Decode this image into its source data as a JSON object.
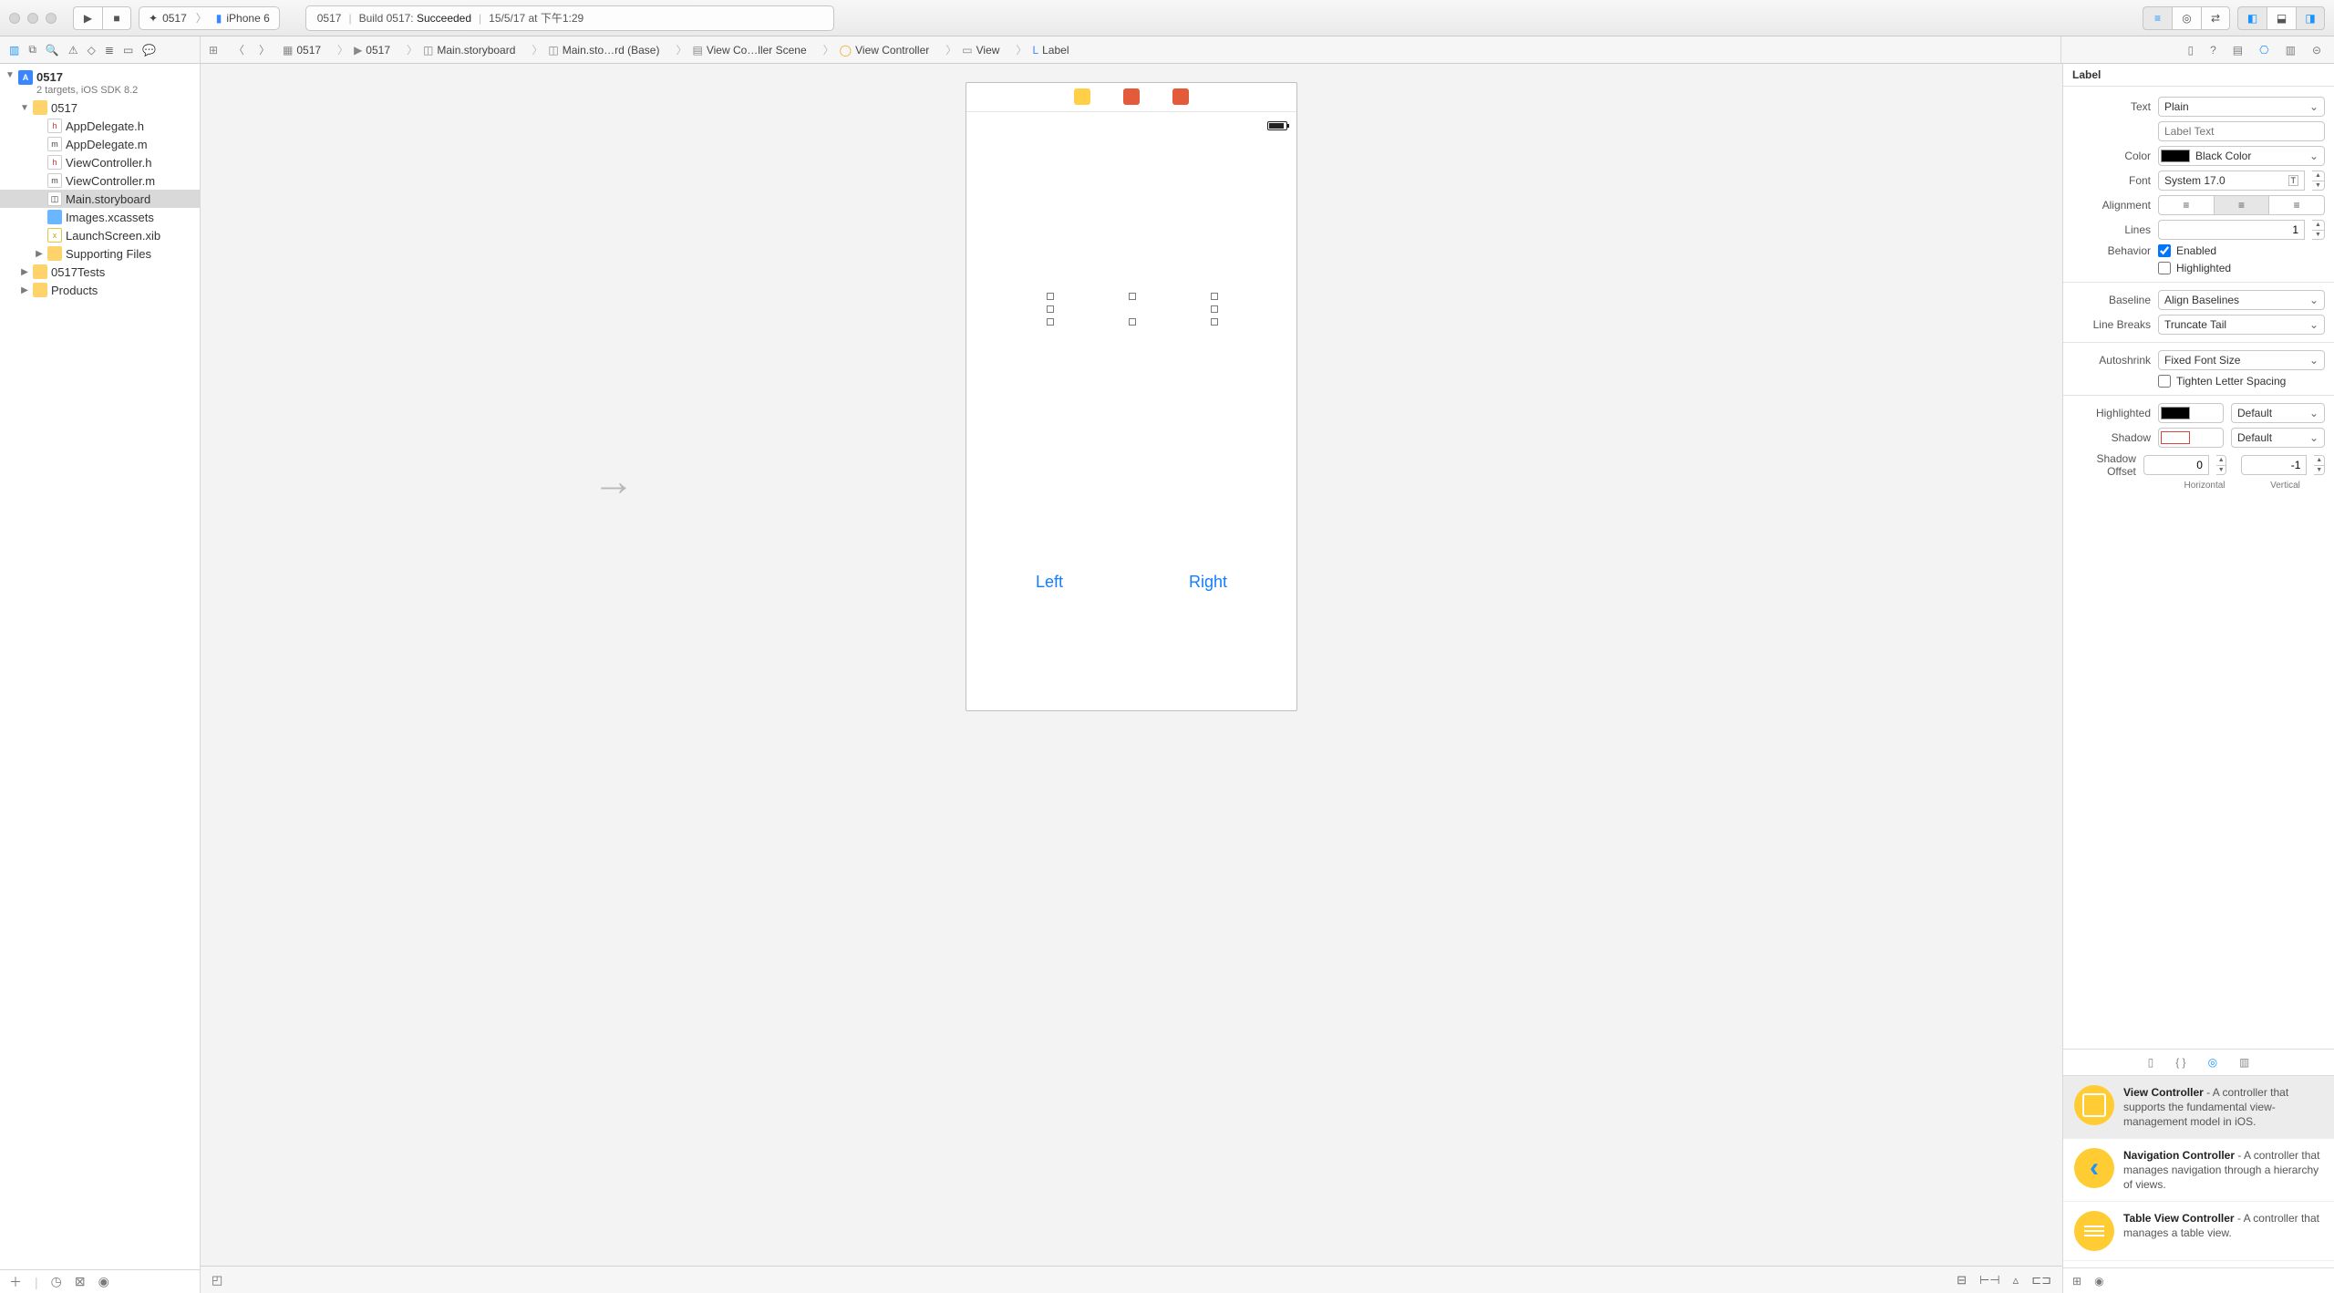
{
  "toolbar": {
    "scheme_target": "0517",
    "scheme_device": "iPhone 6",
    "activity_prefix": "0517",
    "activity_build": "Build 0517:",
    "activity_status": "Succeeded",
    "activity_time": "15/5/17 at 下午1:29"
  },
  "breadcrumbs": [
    {
      "label": "0517",
      "icon": "proj"
    },
    {
      "label": "0517",
      "icon": "folder"
    },
    {
      "label": "Main.storyboard",
      "icon": "sb"
    },
    {
      "label": "Main.sto…rd (Base)",
      "icon": "sb"
    },
    {
      "label": "View Co…ller Scene",
      "icon": "scene"
    },
    {
      "label": "View Controller",
      "icon": "vc"
    },
    {
      "label": "View",
      "icon": "view"
    },
    {
      "label": "Label",
      "icon": "label"
    }
  ],
  "navigator": {
    "project": {
      "name": "0517",
      "subtitle": "2 targets, iOS SDK 8.2"
    },
    "groups": [
      {
        "name": "0517",
        "open": true,
        "children": [
          {
            "name": "AppDelegate.h",
            "kind": "h"
          },
          {
            "name": "AppDelegate.m",
            "kind": "m"
          },
          {
            "name": "ViewController.h",
            "kind": "h"
          },
          {
            "name": "ViewController.m",
            "kind": "m"
          },
          {
            "name": "Main.storyboard",
            "kind": "sb",
            "selected": true
          },
          {
            "name": "Images.xcassets",
            "kind": "assets"
          },
          {
            "name": "LaunchScreen.xib",
            "kind": "xib"
          },
          {
            "name": "Supporting Files",
            "kind": "folder",
            "closed": true
          }
        ]
      },
      {
        "name": "0517Tests",
        "kind": "folder",
        "closed": true
      },
      {
        "name": "Products",
        "kind": "folder",
        "closed": true
      }
    ]
  },
  "canvas": {
    "left_button": "Left",
    "right_button": "Right"
  },
  "inspector": {
    "title": "Label",
    "text_mode": "Plain",
    "text_placeholder": "Label Text",
    "color": "Black Color",
    "color_swatch": "#000000",
    "font": "System 17.0",
    "alignment_selected": 1,
    "lines": "1",
    "behavior_enabled_label": "Enabled",
    "behavior_highlighted_label": "Highlighted",
    "behavior_enabled": true,
    "behavior_highlighted": false,
    "baseline": "Align Baselines",
    "line_breaks": "Truncate Tail",
    "autoshrink": "Fixed Font Size",
    "tighten_label": "Tighten Letter Spacing",
    "tighten": false,
    "highlighted_color": "Default",
    "highlighted_swatch": "#000000",
    "shadow_color": "Default",
    "shadow_offset_h": "0",
    "shadow_offset_v": "-1",
    "offset_h_label": "Horizontal",
    "offset_v_label": "Vertical",
    "labels": {
      "text": "Text",
      "color": "Color",
      "font": "Font",
      "alignment": "Alignment",
      "lines": "Lines",
      "behavior": "Behavior",
      "baseline": "Baseline",
      "line_breaks": "Line Breaks",
      "autoshrink": "Autoshrink",
      "highlighted": "Highlighted",
      "shadow": "Shadow",
      "shadow_offset": "Shadow Offset"
    }
  },
  "library": [
    {
      "title": "View Controller",
      "desc": " - A controller that supports the fundamental view-management model in iOS.",
      "icon": "sq",
      "selected": true
    },
    {
      "title": "Navigation Controller",
      "desc": " - A controller that manages navigation through a hierarchy of views.",
      "icon": "chev"
    },
    {
      "title": "Table View Controller",
      "desc": " - A controller that manages a table view.",
      "icon": "lines"
    }
  ]
}
